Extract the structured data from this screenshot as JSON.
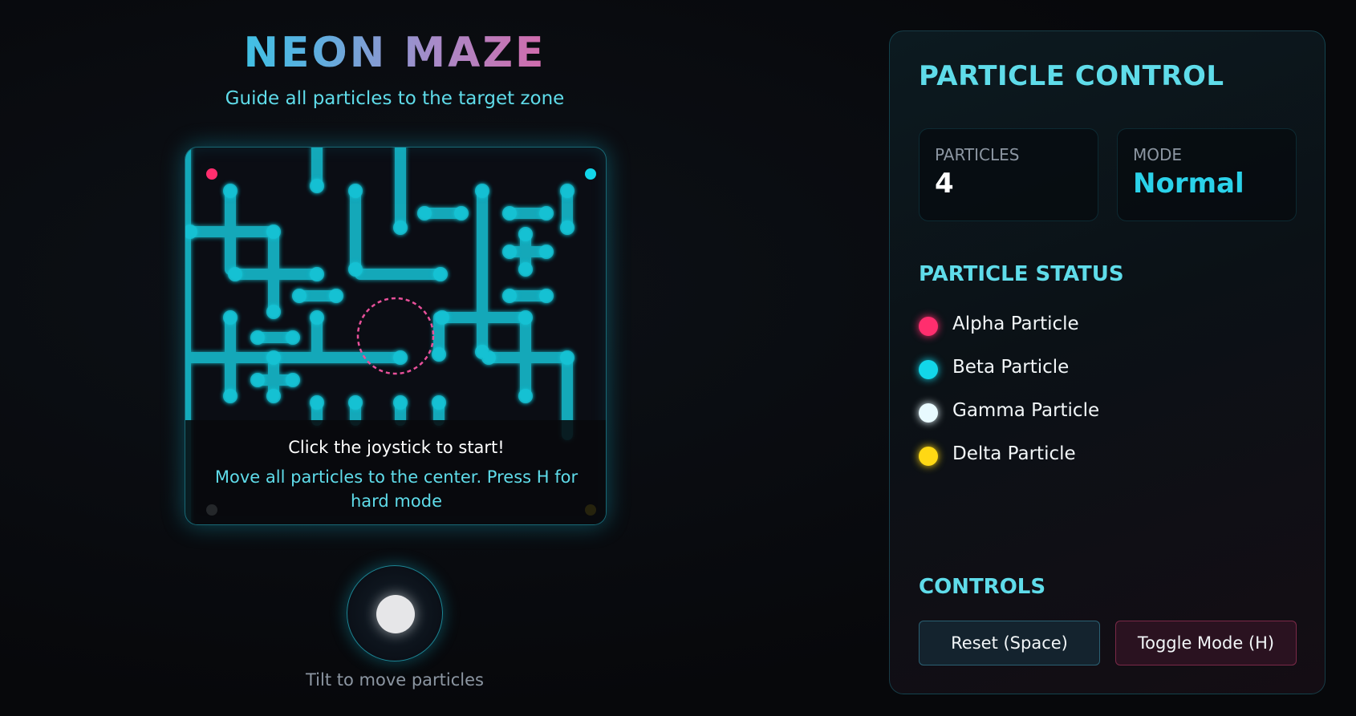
{
  "header": {
    "title": "NEON MAZE",
    "subtitle": "Guide all particles to the target zone"
  },
  "overlay": {
    "title": "Click the joystick to start!",
    "text": "Move all particles to the center. Press H for hard mode"
  },
  "joystick": {
    "label": "Tilt to move particles"
  },
  "panel": {
    "title": "PARTICLE CONTROL",
    "stats": {
      "particles_label": "PARTICLES",
      "particles_value": "4",
      "mode_label": "MODE",
      "mode_value": "Normal"
    },
    "status_title": "PARTICLE STATUS",
    "particles": [
      {
        "label": "Alpha Particle",
        "color": "#ff2e6e"
      },
      {
        "label": "Beta Particle",
        "color": "#12d6ea"
      },
      {
        "label": "Gamma Particle",
        "color": "#e8faff"
      },
      {
        "label": "Delta Particle",
        "color": "#ffd814"
      }
    ],
    "controls_title": "CONTROLS",
    "controls": {
      "reset_label": "Reset (Space)",
      "toggle_label": "Toggle Mode (H)"
    }
  },
  "colors": {
    "accent": "#5fdcea",
    "wall": "#12c4d6",
    "target": "#e8509a",
    "background": "#08090d"
  }
}
